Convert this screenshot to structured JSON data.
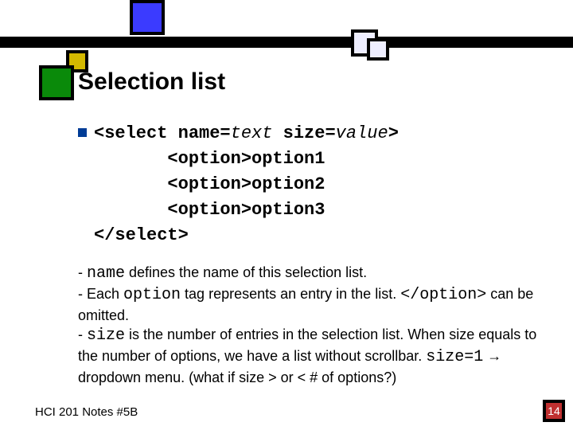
{
  "heading": "Selection list",
  "code": {
    "l1_pre": "<select name=",
    "l1_t": "text",
    "l1_mid": " size=",
    "l1_v": "value",
    "l1_end": ">",
    "l2": "       <option>option1",
    "l3": "       <option>option2",
    "l4": "       <option>option3",
    "l5": "</select>"
  },
  "desc": {
    "dash1": "- ",
    "name_kw": "name",
    "d1_tail": " defines the name of this selection list.",
    "d2_head": "- Each ",
    "option_kw": "option",
    "d2_mid": " tag represents an entry in the list. ",
    "close_opt": "</option>",
    "d2_tail": " can be omitted.",
    "d3_head": "- ",
    "size_kw": "size",
    "d3_tail": " is the number of entries in the selection list. When size equals to the number of options, we have a list without scrollbar. ",
    "size1": "size=1",
    "arrow": " → dropdown menu.  (what if size > or < # of options?)"
  },
  "footer": "HCI 201 Notes #5B",
  "slide_number": "14"
}
